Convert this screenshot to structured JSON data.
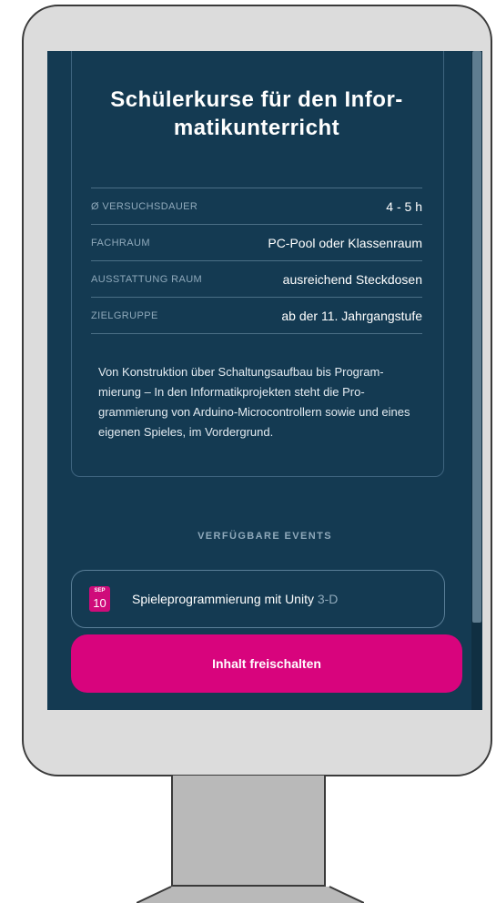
{
  "course": {
    "title": "Schülerkurse für den Infor-matikunterricht",
    "details": [
      {
        "label": "Ø VERSUCHSDAUER",
        "value": "4 - 5 h"
      },
      {
        "label": "FACHRAUM",
        "value": "PC-Pool oder Klassenraum"
      },
      {
        "label": "AUSSTATTUNG RAUM",
        "value": "ausreichend Steckdosen"
      },
      {
        "label": "ZIELGRUPPE",
        "value": "ab der 11. Jahrgangstufe"
      }
    ],
    "description": "Von Konstruktion über Schaltungsaufbau bis Program-mierung – In den Informatikprojekten steht die Pro-grammierung von Arduino-Microcontrollern sowie und eines eigenen Spieles, im Vordergrund."
  },
  "events": {
    "heading": "VERFÜGBARE EVENTS",
    "items": [
      {
        "month": "SEP",
        "day": "10",
        "title": "Spieleprogrammierung mit Unity",
        "suffix": "3-D"
      }
    ]
  },
  "actions": {
    "unlock_label": "Inhalt freischalten"
  },
  "colors": {
    "screen_background": "#143a52",
    "accent": "#d8047d",
    "muted_text": "#8fa9bb"
  }
}
